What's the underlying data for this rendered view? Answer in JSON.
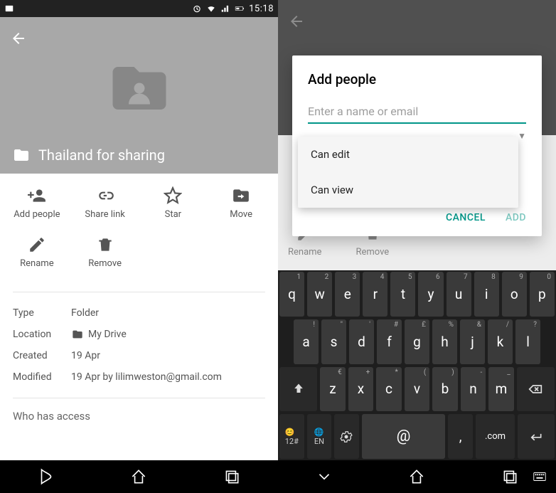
{
  "status": {
    "time": "15:18"
  },
  "left": {
    "title": "Thailand for sharing",
    "actions": [
      {
        "label": "Add people"
      },
      {
        "label": "Share link"
      },
      {
        "label": "Star"
      },
      {
        "label": "Move"
      },
      {
        "label": "Rename"
      },
      {
        "label": "Remove"
      }
    ],
    "meta": {
      "type_key": "Type",
      "type_val": "Folder",
      "loc_key": "Location",
      "loc_val": "My Drive",
      "created_key": "Created",
      "created_val": "19 Apr",
      "mod_key": "Modified",
      "mod_val": "19 Apr by lilimweston@gmail.com"
    },
    "access_label": "Who has access"
  },
  "right": {
    "dialog_title": "Add people",
    "input_placeholder": "Enter a name or email",
    "dd": {
      "edit": "Can edit",
      "view": "Can view"
    },
    "cancel": "CANCEL",
    "add": "ADD",
    "bg_actions": {
      "rename": "Rename",
      "remove": "Remove"
    },
    "kb": {
      "r1": [
        "q",
        "w",
        "e",
        "r",
        "t",
        "y",
        "u",
        "i",
        "o",
        "p"
      ],
      "r1h": [
        "1",
        "2",
        "3",
        "4",
        "5",
        "6",
        "7",
        "8",
        "9",
        "0"
      ],
      "r2": [
        "a",
        "s",
        "d",
        "f",
        "g",
        "h",
        "j",
        "k",
        "l"
      ],
      "r2h": [
        "!",
        "\"",
        "'",
        "#",
        "£",
        "%",
        "&",
        "/",
        "?"
      ],
      "r3": [
        "z",
        "x",
        "c",
        "v",
        "b",
        "n",
        "m"
      ],
      "r3h": [
        "€",
        "+",
        "*",
        "(",
        ")",
        "-",
        "_"
      ],
      "r4": {
        "num": "12#",
        "lang": "EN",
        "at": "@",
        "comma": ",",
        "com": ".com"
      }
    }
  }
}
